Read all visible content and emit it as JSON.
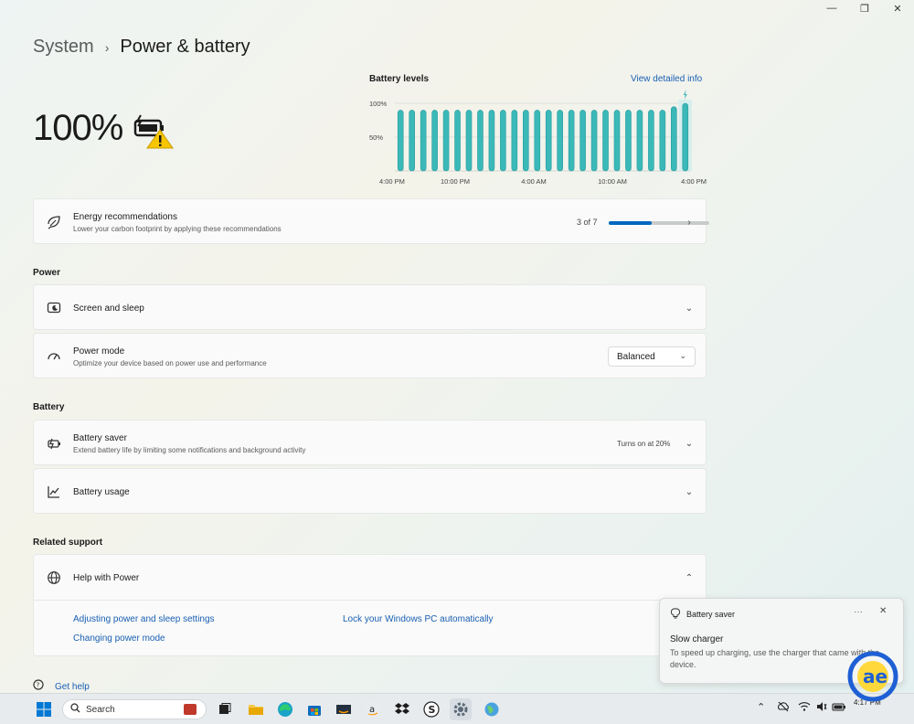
{
  "window": {
    "minimize": "—",
    "maximize": "❐",
    "close": "✕"
  },
  "breadcrumb": {
    "parent": "System",
    "separator": "›",
    "current": "Power & battery"
  },
  "battery": {
    "percent": "100%"
  },
  "battery_levels": {
    "title": "Battery levels",
    "link": "View detailed info",
    "y_labels": [
      "100%",
      "50%"
    ],
    "x_labels": [
      "4:00 PM",
      "10:00 PM",
      "4:00 AM",
      "10:00 AM",
      "4:00 PM"
    ],
    "bar_color": "#3bb8b8",
    "chart_data": {
      "type": "bar",
      "ylim": [
        0,
        100
      ],
      "values": [
        90,
        90,
        90,
        90,
        90,
        90,
        90,
        90,
        90,
        90,
        90,
        90,
        90,
        90,
        90,
        90,
        90,
        90,
        90,
        90,
        90,
        90,
        90,
        90,
        95,
        100
      ],
      "highlight_last": true
    }
  },
  "energy": {
    "title": "Energy recommendations",
    "subtitle": "Lower your carbon footprint by applying these recommendations",
    "progress_text": "3 of 7",
    "progress_fraction": 0.428
  },
  "sections": {
    "power": "Power",
    "battery": "Battery",
    "related": "Related support"
  },
  "screen_sleep": {
    "title": "Screen and sleep"
  },
  "power_mode": {
    "title": "Power mode",
    "subtitle": "Optimize your device based on power use and performance",
    "value": "Balanced"
  },
  "battery_saver": {
    "title": "Battery saver",
    "subtitle": "Extend battery life by limiting some notifications and background activity",
    "status": "Turns on at 20%"
  },
  "battery_usage": {
    "title": "Battery usage"
  },
  "help_power": {
    "title": "Help with Power",
    "links": [
      "Adjusting power and sleep settings",
      "Lock your Windows PC automatically",
      "Changing power mode"
    ]
  },
  "get_help": "Get help",
  "toast": {
    "app": "Battery saver",
    "more": "···",
    "close": "✕",
    "title": "Slow charger",
    "body": "To speed up charging, use the charger that came with the device."
  },
  "taskbar": {
    "search_placeholder": "Search",
    "clock_time": "4:17 PM"
  }
}
